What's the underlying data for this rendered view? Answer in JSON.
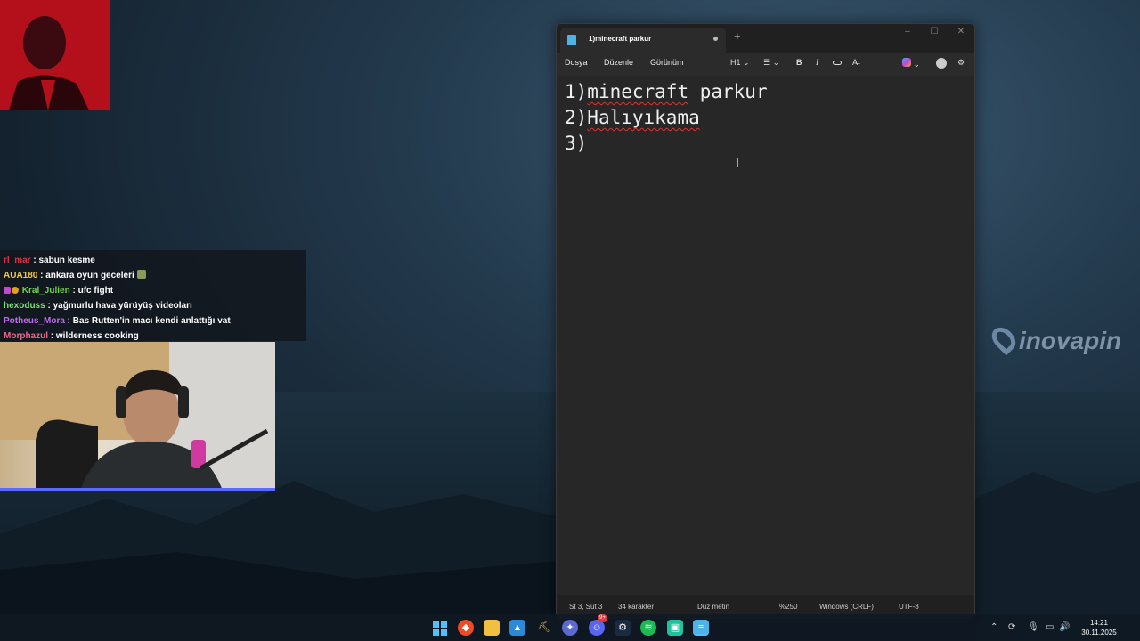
{
  "chat": {
    "messages": [
      {
        "user": "rl_mar",
        "sep": " : ",
        "text": "sabun kesme",
        "color": "#d8324a"
      },
      {
        "user": "AUA180",
        "sep": " : ",
        "text": "ankara oyun geceleri",
        "color": "#f2c94c"
      },
      {
        "user": "Kral_Julien",
        "sep": " : ",
        "text": "ufc fight",
        "color": "#6fd04a"
      },
      {
        "user": "hexoduss",
        "sep": " : ",
        "text": "yağmurlu hava yürüyüş videoları",
        "color": "#7fe07a"
      },
      {
        "user": "Potheus_Mora",
        "sep": " : ",
        "text": "Bas Rutten'in macı kendi anlattığı vat",
        "color": "#c06cf0"
      },
      {
        "user": "Morphazul",
        "sep": " : ",
        "text": "wilderness cooking",
        "color": "#e86a8a"
      }
    ]
  },
  "brand": {
    "text": "inovapin"
  },
  "notepad": {
    "tab_title": "1)minecraft parkur",
    "add_tab": "+",
    "window_buttons": {
      "minimize": "–",
      "maximize": "☐",
      "close": "✕"
    },
    "menu": {
      "file": "Dosya",
      "edit": "Düzenle",
      "view": "Görünüm"
    },
    "toolbar": {
      "heading": "H1",
      "list": "☰",
      "bold": "B",
      "italic": "I",
      "link": "🔗",
      "clear": "A̶"
    },
    "lines": [
      {
        "prefix": "1)",
        "word": "minecraft",
        "rest": " parkur"
      },
      {
        "prefix": "2)",
        "word": "Halıyıkama",
        "rest": ""
      },
      {
        "prefix": "3)",
        "word": "",
        "rest": ""
      }
    ],
    "status": {
      "position": "St 3, Süt 3",
      "chars": "34 karakter",
      "format": "Düz metin",
      "zoom": "%250",
      "line_ending": "Windows (CRLF)",
      "encoding": "UTF-8"
    }
  },
  "taskbar": {
    "time": "14:21",
    "date": "30.11.2025",
    "discord_badge": "9+"
  }
}
